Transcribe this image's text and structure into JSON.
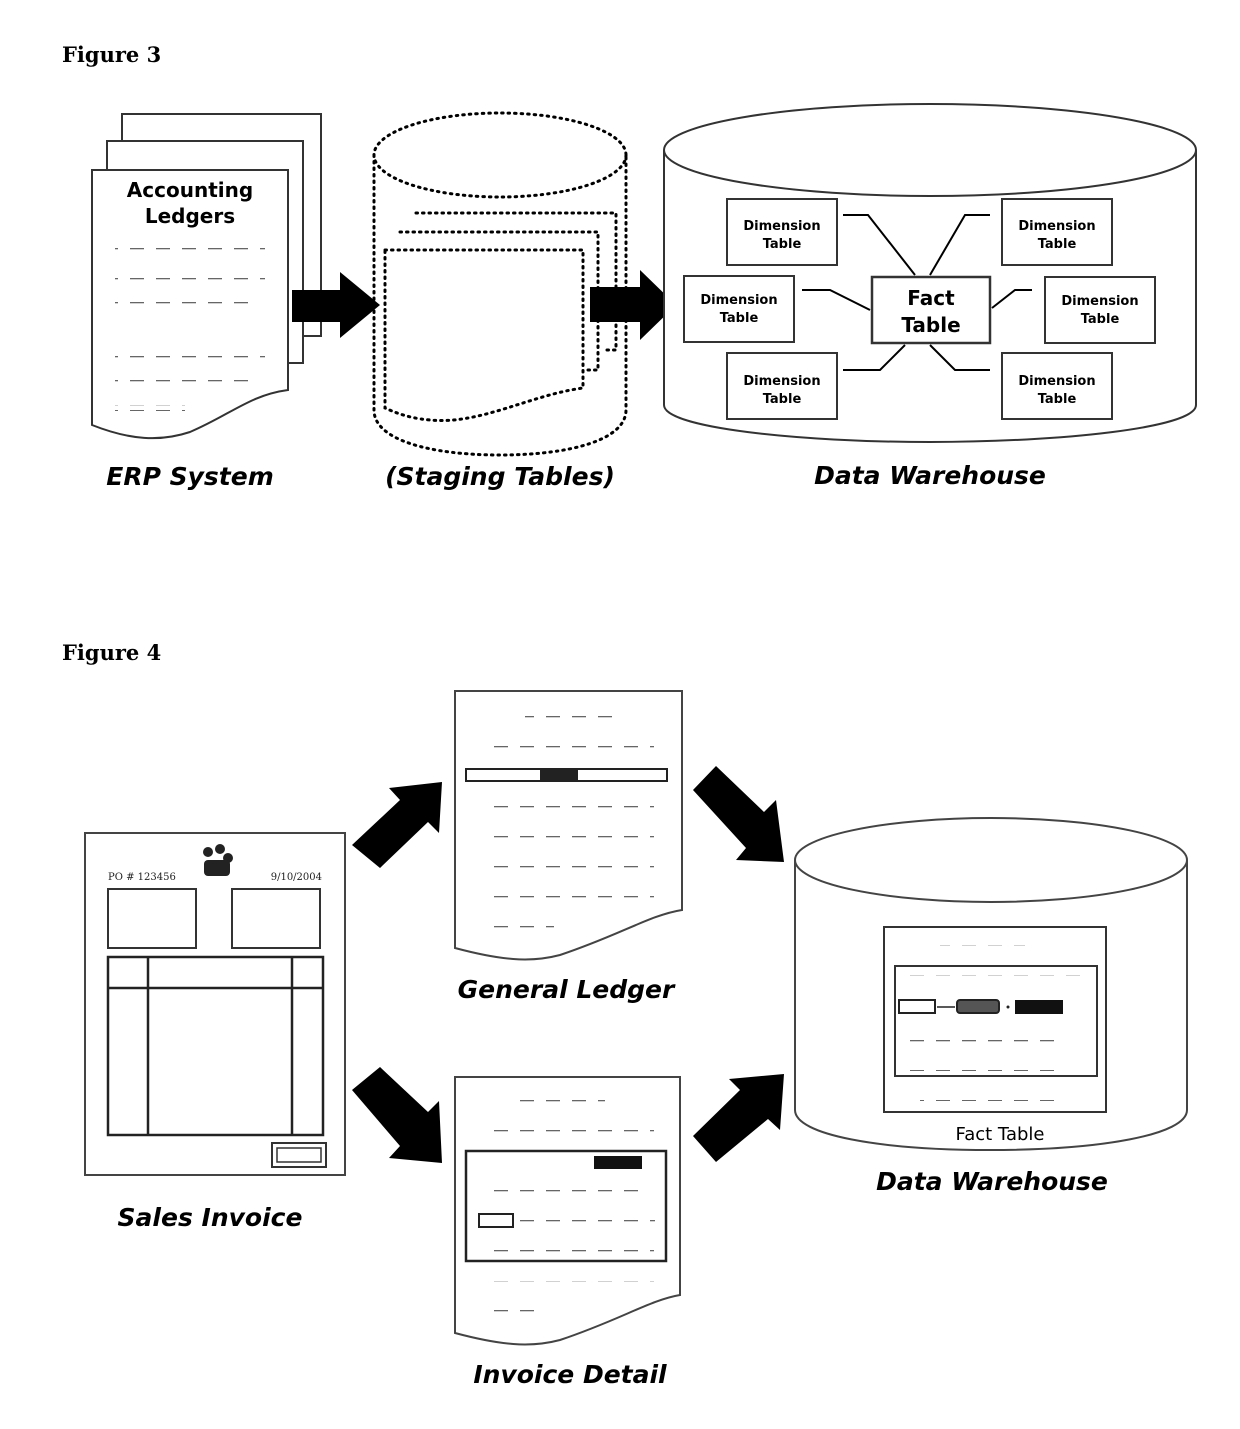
{
  "figure3": {
    "title": "Figure 3",
    "erp": {
      "doc_title_line1": "Accounting",
      "doc_title_line2": "Ledgers",
      "label": "ERP System"
    },
    "staging": {
      "label": "(Staging Tables)"
    },
    "warehouse": {
      "label": "Data Warehouse",
      "fact_line1": "Fact",
      "fact_line2": "Table",
      "dimension_line1": "Dimension",
      "dimension_line2": "Table",
      "dimension_count": 6
    },
    "flow": [
      "Accounting Ledgers",
      "Staging Tables",
      "Data Warehouse"
    ]
  },
  "figure4": {
    "title": "Figure 4",
    "sales_invoice": {
      "label": "Sales Invoice",
      "po_number": "PO # 123456",
      "date": "9/10/2004"
    },
    "general_ledger": {
      "label": "General Ledger"
    },
    "invoice_detail": {
      "label": "Invoice Detail"
    },
    "warehouse": {
      "label": "Data Warehouse",
      "fact_table_label": "Fact Table"
    },
    "flows": [
      [
        "Sales Invoice",
        "General Ledger"
      ],
      [
        "Sales Invoice",
        "Invoice Detail"
      ],
      [
        "General Ledger",
        "Data Warehouse"
      ],
      [
        "Invoice Detail",
        "Data Warehouse"
      ]
    ]
  }
}
